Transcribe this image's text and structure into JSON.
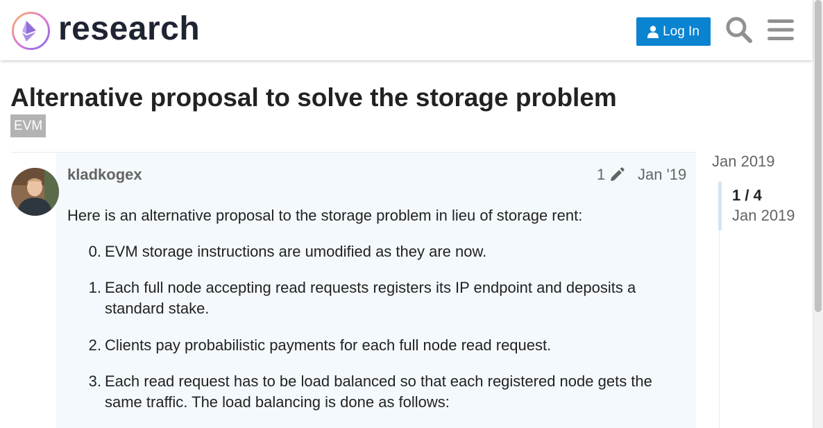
{
  "header": {
    "site_name": "research",
    "login_label": "Log In",
    "icons": [
      "ethereum-logo-icon",
      "user-icon",
      "search-icon",
      "hamburger-menu-icon"
    ]
  },
  "topic": {
    "title": "Alternative proposal to solve the storage problem",
    "category": "EVM"
  },
  "post": {
    "username": "kladkogex",
    "edit_count": "1",
    "date": "Jan '19",
    "intro": "Here is an alternative proposal to the storage problem in lieu of storage rent:",
    "items": [
      {
        "num": "0.",
        "text": "EVM storage instructions are umodified as they are now."
      },
      {
        "num": "1.",
        "text": "Each full node accepting read requests registers its IP endpoint and deposits a standard stake."
      },
      {
        "num": "2.",
        "text": "Clients pay probabilistic payments for each full node read request."
      },
      {
        "num": "3.",
        "text": "Each read request has to be load balanced so that each registered node gets the same traffic. The load balancing is done as follows:"
      }
    ]
  },
  "timeline": {
    "start_date": "Jan 2019",
    "position": "1 / 4",
    "current_date": "Jan 2019"
  },
  "colors": {
    "accent": "#0a83d1",
    "post_background": "#f4f9fd",
    "tag_background": "#b3b3b3",
    "muted_text": "#646464"
  }
}
